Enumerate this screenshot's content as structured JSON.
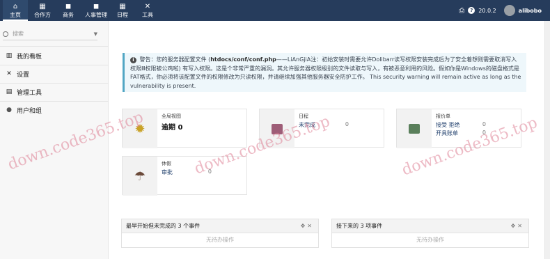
{
  "nav": {
    "items": [
      {
        "label": "主页",
        "icon": "home-icon",
        "glyph": "⌂"
      },
      {
        "label": "合作方",
        "icon": "building-icon",
        "glyph": "▦"
      },
      {
        "label": "商务",
        "icon": "briefcase-icon",
        "glyph": "◼"
      },
      {
        "label": "人事管理",
        "icon": "hrm-icon",
        "glyph": "◼"
      },
      {
        "label": "日程",
        "icon": "calendar-icon",
        "glyph": "▦"
      },
      {
        "label": "工具",
        "icon": "tools-icon",
        "glyph": "✕"
      }
    ],
    "right": {
      "print_glyph": "⎙",
      "help_glyph": "?",
      "version": "20.0.2",
      "user": "alibobo"
    }
  },
  "sidebar": {
    "search_placeholder": "搜索",
    "items": [
      {
        "label": "我的看板",
        "glyph": "▥",
        "icon": "chart-icon"
      },
      {
        "label": "设置",
        "glyph": "✕",
        "icon": "wrench-icon"
      },
      {
        "label": "管理工具",
        "glyph": "▤",
        "icon": "admin-tools-icon"
      },
      {
        "label": "用户和组",
        "glyph": "●",
        "icon": "user-icon"
      }
    ]
  },
  "warning": {
    "prefix": "警告：您的服务器配置文件 (",
    "path": "htdocs/conf/conf.php",
    "text": "——LiAnGjiA注：初始安装时需要允许Dolibarr读写权限安装完成后为了安全着想则需要取消写入权限Ⅲ权限被公鸡啦) 有写入权限。这是个非常严重的漏洞。其允许服务器权限级别的文件读取与写入，有被恶意利用的风险。假如你是Windows的磁盘格式是FAT格式，你必须将该配置文件的权限修改为只读权限，并请继续加强其他服务器安全防护工作。 This security warning will remain active as long as the vulnerability is present."
  },
  "boxes": {
    "overview": {
      "title": "全局视图",
      "label": "逾期",
      "count": "0"
    },
    "agenda": {
      "title": "日程",
      "row1": "未完成",
      "row1_val": "0"
    },
    "proposals": {
      "title": "报价单",
      "row1": "接受 拒绝",
      "row1_val": "0",
      "row2": "开具账单",
      "row2_val": "0"
    },
    "leave": {
      "title": "休假",
      "row1": "审批",
      "row1_val": "0"
    }
  },
  "panels": {
    "left": {
      "title": "最早开始但未完成的 3 个事件",
      "empty": "无待办操作"
    },
    "right": {
      "title": "接下来的 3 项事件",
      "empty": "无待办操作"
    },
    "controls": "✥✕"
  },
  "watermark": "down.code365.top"
}
